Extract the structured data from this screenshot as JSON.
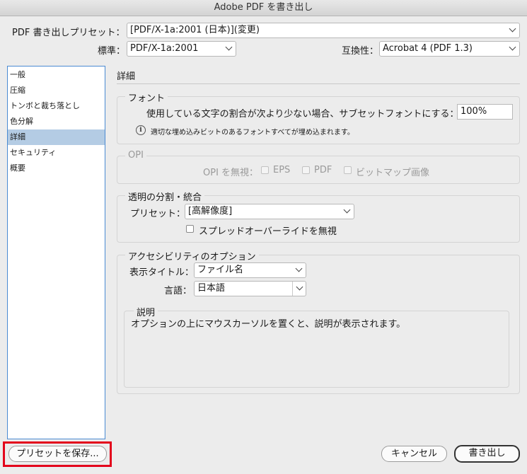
{
  "window": {
    "title": "Adobe PDF を書き出し"
  },
  "top": {
    "preset_label": "PDF 書き出しプリセット：",
    "preset_value": "[PDF/X-1a:2001 (日本)](変更)",
    "standard_label": "標準：",
    "standard_value": "PDF/X-1a:2001",
    "compat_label": "互換性：",
    "compat_value": "Acrobat 4 (PDF 1.3)"
  },
  "sidebar": {
    "items": [
      {
        "label": "一般"
      },
      {
        "label": "圧縮"
      },
      {
        "label": "トンボと裁ち落とし"
      },
      {
        "label": "色分解"
      },
      {
        "label": "詳細",
        "selected": true
      },
      {
        "label": "セキュリティ"
      },
      {
        "label": "概要"
      }
    ]
  },
  "panel": {
    "title": "詳細",
    "font": {
      "legend": "フォント",
      "subset_label": "使用している文字の割合が次より少ない場合、サブセットフォントにする：",
      "subset_value": "100%",
      "info_text": "適切な埋め込みビットのあるフォントすべてが埋め込まれます。"
    },
    "opi": {
      "legend": "OPI",
      "omit_label": "OPI を無視：",
      "eps": "EPS",
      "pdf": "PDF",
      "bitmap": "ビットマップ画像"
    },
    "flatten": {
      "legend": "透明の分割・統合",
      "preset_label": "プリセット：",
      "preset_value": "[高解像度]",
      "ignore_spread_label": "スプレッドオーバーライドを無視"
    },
    "access": {
      "legend": "アクセシビリティのオプション",
      "display_title_label": "表示タイトル：",
      "display_title_value": "ファイル名",
      "lang_label": "言語：",
      "lang_value": "日本語"
    },
    "desc": {
      "legend": "説明",
      "text": "オプションの上にマウスカーソルを置くと、説明が表示されます。"
    }
  },
  "buttons": {
    "save_preset": "プリセットを保存...",
    "cancel": "キャンセル",
    "export": "書き出し"
  },
  "colors": {
    "highlight": "#e3001b",
    "selection": "#b4cce4"
  }
}
